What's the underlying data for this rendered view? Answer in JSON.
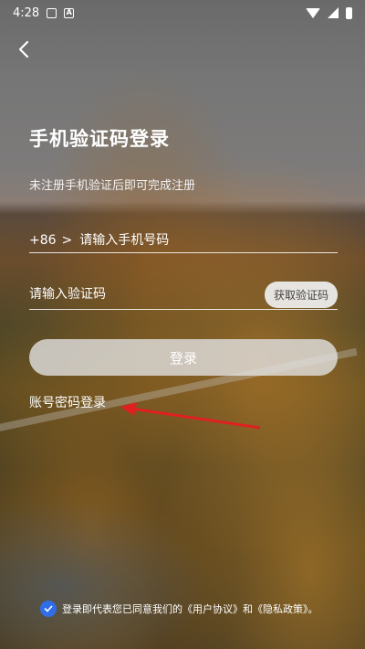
{
  "status_bar": {
    "time": "4:28",
    "badge_letter": "A"
  },
  "header": {
    "title": "手机验证码登录",
    "subtitle": "未注册手机验证后即可完成注册"
  },
  "phone": {
    "country_code": "+86",
    "chevron": ">",
    "placeholder": "请输入手机号码"
  },
  "code": {
    "placeholder": "请输入验证码",
    "get_code_label": "获取验证码"
  },
  "login_button": "登录",
  "password_login_link": "账号密码登录",
  "agreement": {
    "text": "登录即代表您已同意我们的《用户协议》和《隐私政策》。",
    "checked": true
  },
  "colors": {
    "accent": "#2f6ee6",
    "annotation_arrow": "#e02020"
  }
}
